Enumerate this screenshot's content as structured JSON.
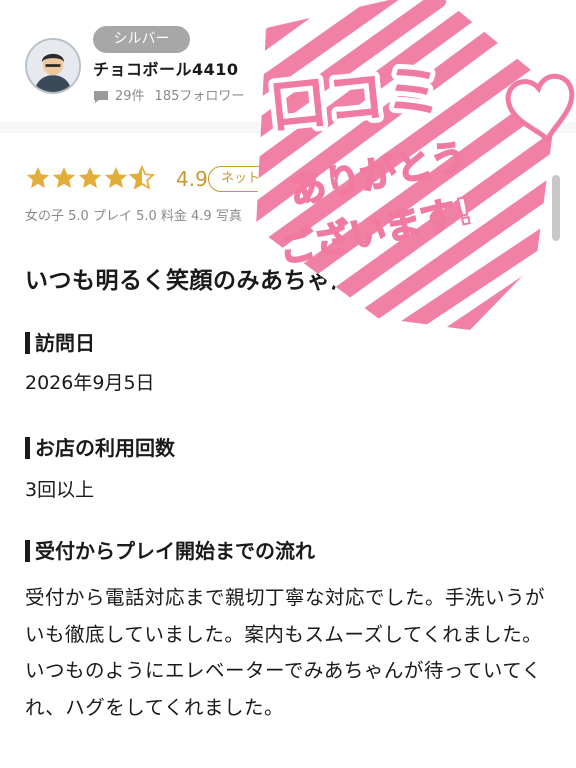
{
  "user": {
    "rank": "シルバー",
    "name": "チョコボール4410",
    "review_count": "29件",
    "followers": "185フォロワー"
  },
  "rating": {
    "stars_value": 4.5,
    "stars_max": 5,
    "score": "4.9",
    "badge": "ネット",
    "subscores": "女の子 5.0  プレイ 5.0  料金 4.9  写真"
  },
  "review": {
    "title": "いつも明るく笑顔のみあちゃん",
    "visit_label": "訪問日",
    "visit_date": "2026年9月5日",
    "usage_label": "お店の利用回数",
    "usage_value": "3回以上",
    "flow_label": "受付からプレイ開始までの流れ",
    "flow_text": "受付から電話対応まで親切丁寧な対応でした。手洗いうがいも徹底していました。案内もスムーズしてくれました。いつものようにエレベーターでみあちゃんが待っていてくれ、ハグをしてくれました。"
  },
  "stamp": {
    "line1": "口コミ",
    "line2": "ありがとう",
    "line3": "ございます!",
    "color": "#f07aa0"
  },
  "colors": {
    "star": "#e3ad3a",
    "score": "#c89a2e",
    "badge_gray": "#a7a7a7"
  }
}
